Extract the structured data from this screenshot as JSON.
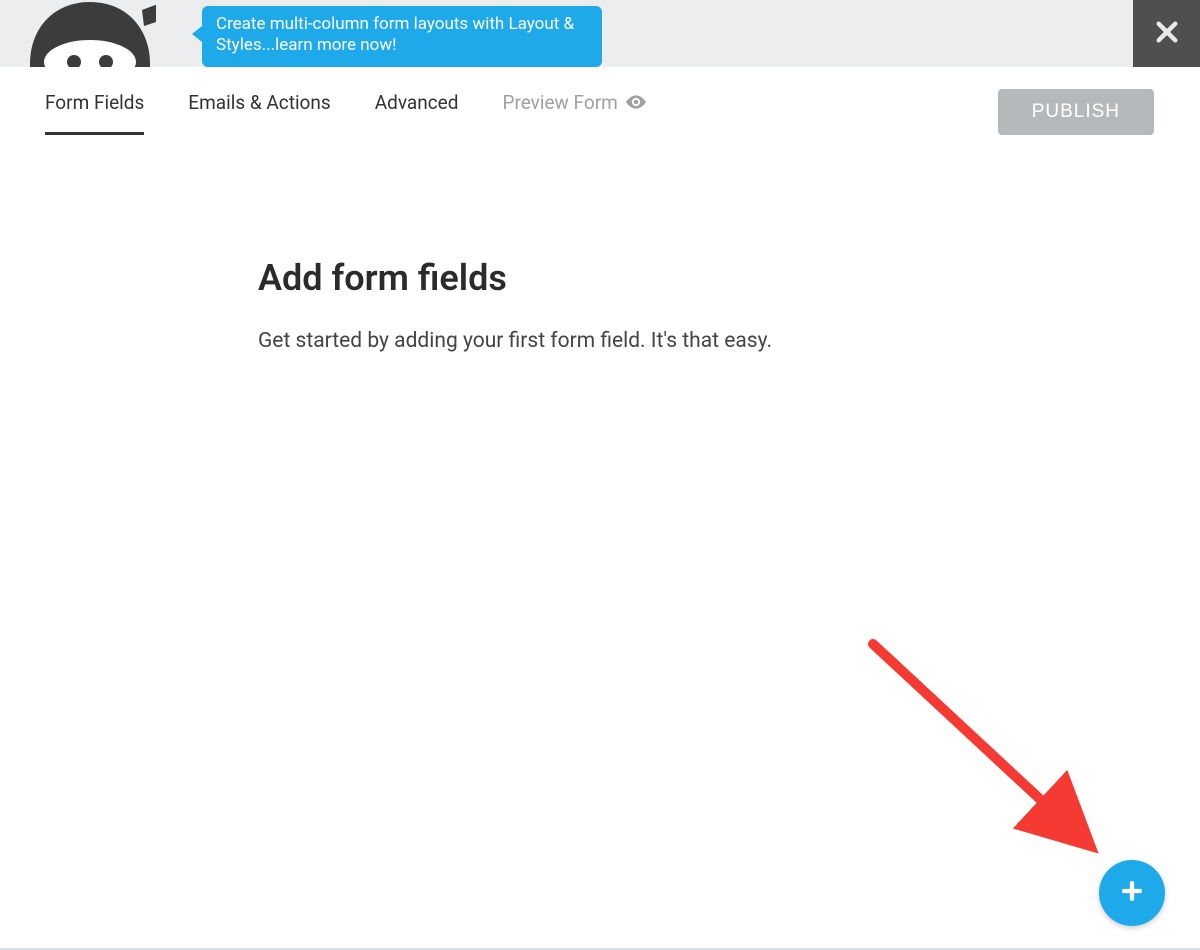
{
  "banner": {
    "promo_text": "Create multi-column form layouts with Layout & Styles...learn more now!"
  },
  "tabs": {
    "items": [
      {
        "label": "Form Fields",
        "active": true
      },
      {
        "label": "Emails & Actions",
        "active": false
      },
      {
        "label": "Advanced",
        "active": false
      },
      {
        "label": "Preview Form",
        "active": false,
        "muted": true
      }
    ]
  },
  "actions": {
    "publish_label": "PUBLISH"
  },
  "empty_state": {
    "heading": "Add form fields",
    "body": "Get started by adding your first form field. It's that easy."
  },
  "colors": {
    "brand_blue": "#1ea9ea",
    "banner_bg": "#ebedee",
    "close_bg": "#4f4f4f",
    "publish_bg": "#b6b9bb",
    "arrow_red": "#f43a32"
  }
}
